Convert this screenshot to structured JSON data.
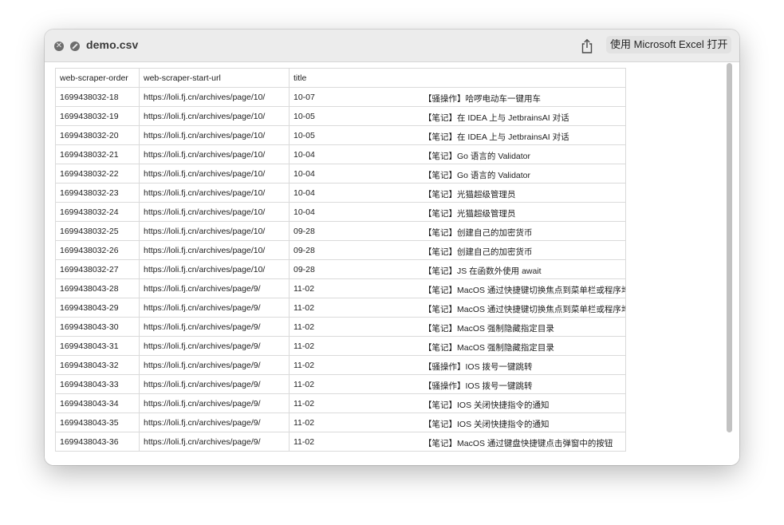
{
  "window": {
    "title": "demo.csv",
    "open_button_label": "使用 Microsoft Excel 打开"
  },
  "table": {
    "headers": [
      "web-scraper-order",
      "web-scraper-start-url",
      "title"
    ],
    "rows": [
      {
        "order": "1699438032-18",
        "url": "https://loli.fj.cn/archives/page/10/",
        "date": "10-07",
        "title": "【骚操作】哈啰电动车一键用车"
      },
      {
        "order": "1699438032-19",
        "url": "https://loli.fj.cn/archives/page/10/",
        "date": "10-05",
        "title": "【笔记】在 IDEA 上与 JetbrainsAI 对话"
      },
      {
        "order": "1699438032-20",
        "url": "https://loli.fj.cn/archives/page/10/",
        "date": "10-05",
        "title": "【笔记】在 IDEA 上与 JetbrainsAI 对话"
      },
      {
        "order": "1699438032-21",
        "url": "https://loli.fj.cn/archives/page/10/",
        "date": "10-04",
        "title": "【笔记】Go 语言的 Validator"
      },
      {
        "order": "1699438032-22",
        "url": "https://loli.fj.cn/archives/page/10/",
        "date": "10-04",
        "title": "【笔记】Go 语言的 Validator"
      },
      {
        "order": "1699438032-23",
        "url": "https://loli.fj.cn/archives/page/10/",
        "date": "10-04",
        "title": "【笔记】光猫超级管理员"
      },
      {
        "order": "1699438032-24",
        "url": "https://loli.fj.cn/archives/page/10/",
        "date": "10-04",
        "title": "【笔记】光猫超级管理员"
      },
      {
        "order": "1699438032-25",
        "url": "https://loli.fj.cn/archives/page/10/",
        "date": "09-28",
        "title": "【笔记】创建自己的加密货币"
      },
      {
        "order": "1699438032-26",
        "url": "https://loli.fj.cn/archives/page/10/",
        "date": "09-28",
        "title": "【笔记】创建自己的加密货币"
      },
      {
        "order": "1699438032-27",
        "url": "https://loli.fj.cn/archives/page/10/",
        "date": "09-28",
        "title": "【笔记】JS 在函数外使用 await"
      },
      {
        "order": "1699438043-28",
        "url": "https://loli.fj.cn/archives/page/9/",
        "date": "11-02",
        "title": "【笔记】MacOS 通过快捷键切换焦点到菜单栏或程序坞"
      },
      {
        "order": "1699438043-29",
        "url": "https://loli.fj.cn/archives/page/9/",
        "date": "11-02",
        "title": "【笔记】MacOS 通过快捷键切换焦点到菜单栏或程序坞"
      },
      {
        "order": "1699438043-30",
        "url": "https://loli.fj.cn/archives/page/9/",
        "date": "11-02",
        "title": "【笔记】MacOS 强制隐藏指定目录"
      },
      {
        "order": "1699438043-31",
        "url": "https://loli.fj.cn/archives/page/9/",
        "date": "11-02",
        "title": "【笔记】MacOS 强制隐藏指定目录"
      },
      {
        "order": "1699438043-32",
        "url": "https://loli.fj.cn/archives/page/9/",
        "date": "11-02",
        "title": "【骚操作】IOS 拨号一键跳转"
      },
      {
        "order": "1699438043-33",
        "url": "https://loli.fj.cn/archives/page/9/",
        "date": "11-02",
        "title": "【骚操作】IOS 拨号一键跳转"
      },
      {
        "order": "1699438043-34",
        "url": "https://loli.fj.cn/archives/page/9/",
        "date": "11-02",
        "title": "【笔记】IOS 关闭快捷指令的通知"
      },
      {
        "order": "1699438043-35",
        "url": "https://loli.fj.cn/archives/page/9/",
        "date": "11-02",
        "title": "【笔记】IOS 关闭快捷指令的通知"
      },
      {
        "order": "1699438043-36",
        "url": "https://loli.fj.cn/archives/page/9/",
        "date": "11-02",
        "title": "【笔记】MacOS 通过键盘快捷键点击弹窗中的按钮"
      }
    ]
  },
  "icons": {
    "close": "close-icon",
    "disabled": "no-entry-icon",
    "share": "share-icon"
  },
  "colors": {
    "titlebar": "#ececec",
    "grid_border": "#dadada",
    "scroll_thumb": "#c2c2c2"
  }
}
